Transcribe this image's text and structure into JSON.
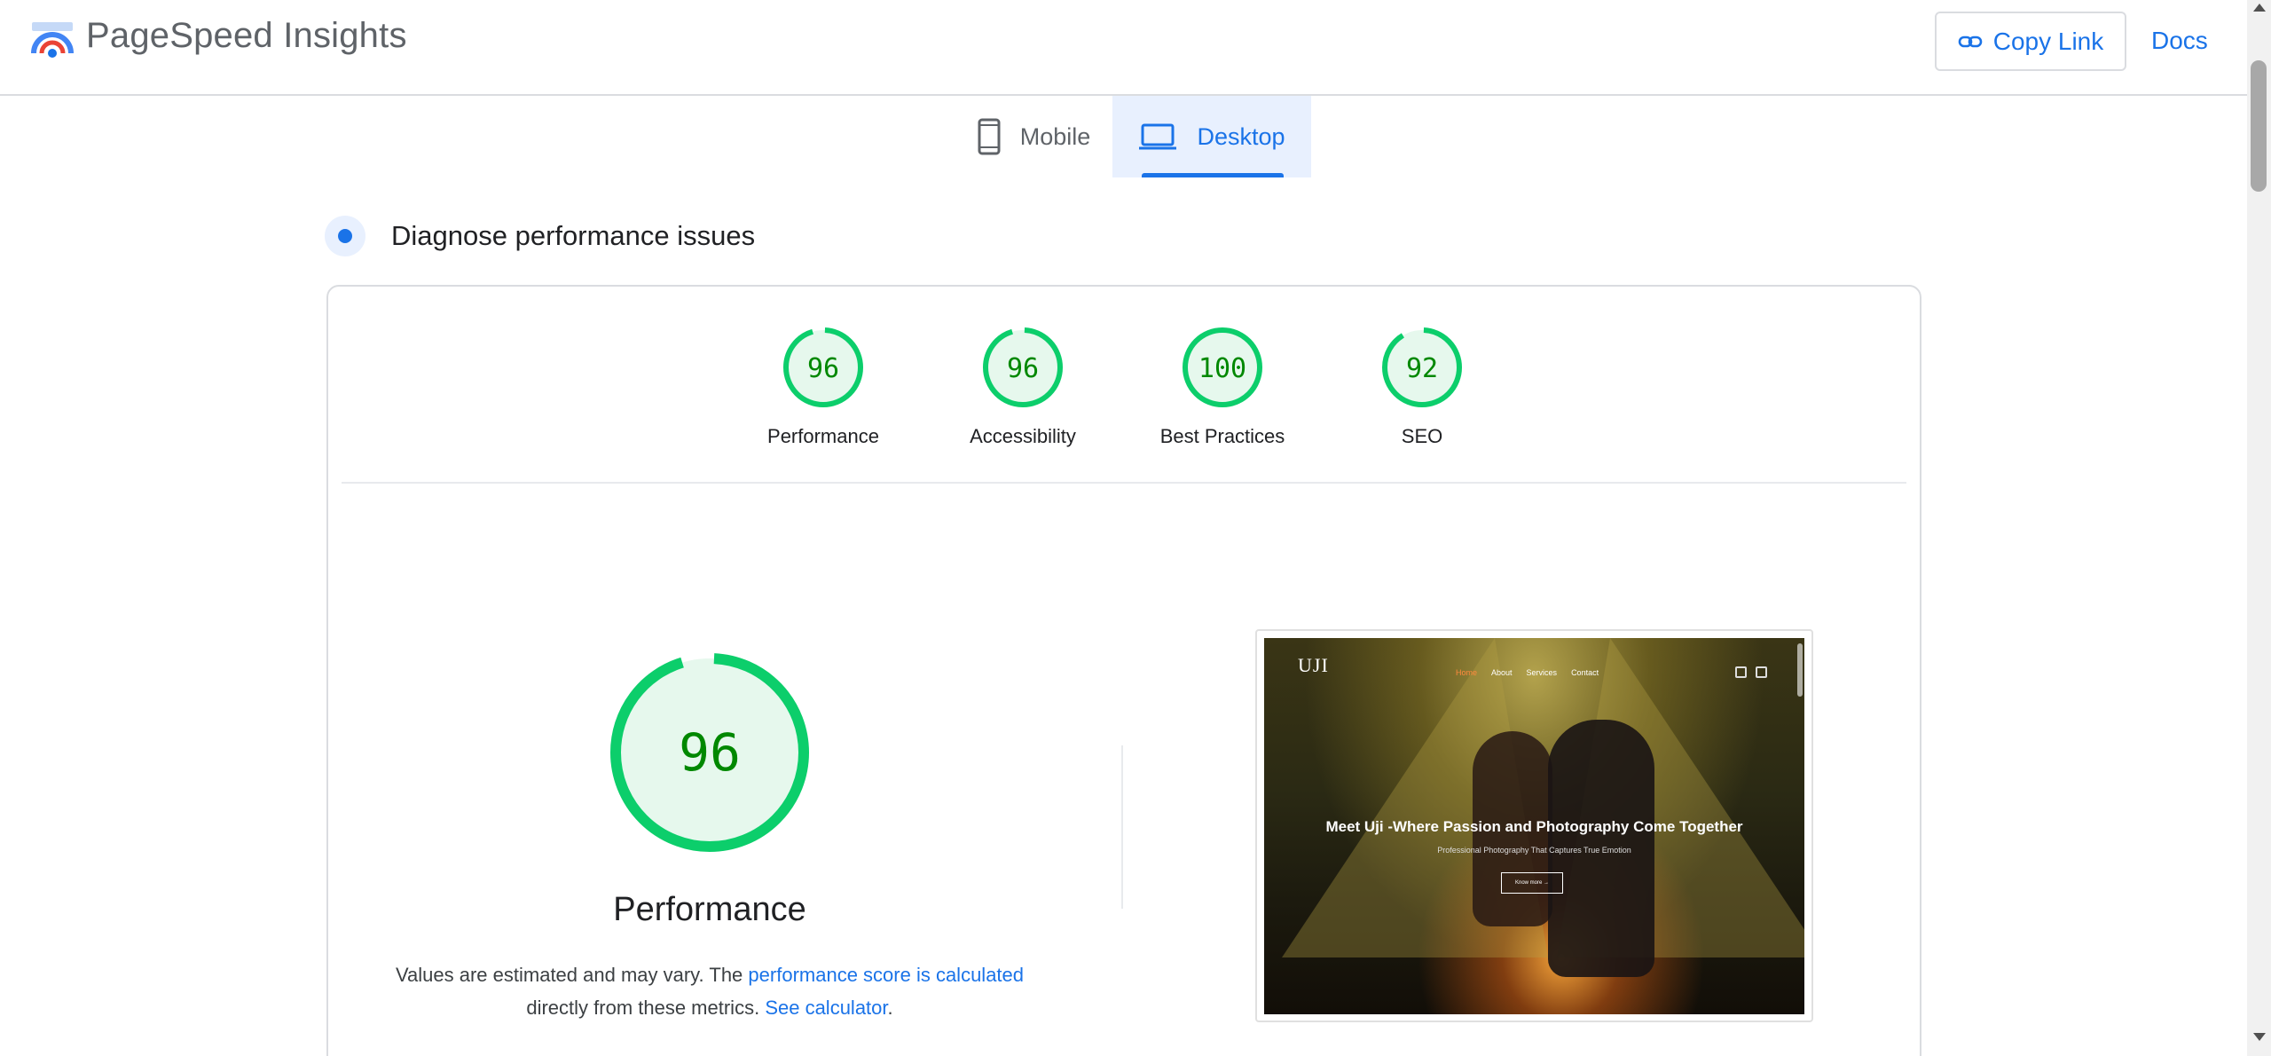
{
  "header": {
    "title": "PageSpeed Insights",
    "copy_link_label": "Copy Link",
    "docs_label": "Docs",
    "logo_icon": "pagespeed-logo-icon"
  },
  "tabs": [
    {
      "label": "Mobile",
      "icon": "phone-icon",
      "selected": false
    },
    {
      "label": "Desktop",
      "icon": "laptop-icon",
      "selected": true
    }
  ],
  "section": {
    "title": "Diagnose performance issues"
  },
  "summary_scores": [
    {
      "label": "Performance",
      "score": "96",
      "fraction": 0.96
    },
    {
      "label": "Accessibility",
      "score": "96",
      "fraction": 0.96
    },
    {
      "label": "Best Practices",
      "score": "100",
      "fraction": 1.0
    },
    {
      "label": "SEO",
      "score": "92",
      "fraction": 0.92
    }
  ],
  "performance": {
    "score": "96",
    "fraction": 0.96,
    "title": "Performance",
    "note_text": "Values are estimated and may vary. The",
    "note_link": "performance score is calculated",
    "note_text2": "directly from these metrics.",
    "calculator_link": "See calculator",
    "period": "."
  },
  "screenshot": {
    "logo_text": "UJI",
    "nav": [
      "Home",
      "About",
      "Services",
      "Contact"
    ],
    "headline": "Meet Uji -Where Passion and Photography Come Together",
    "subheadline": "Professional Photography That Captures True Emotion",
    "button": "Know more →"
  },
  "colors": {
    "accent": "#1a73e8",
    "pass_green": "#0cce6b",
    "pass_text": "#008800",
    "pass_fill": "#e6f8ed"
  }
}
